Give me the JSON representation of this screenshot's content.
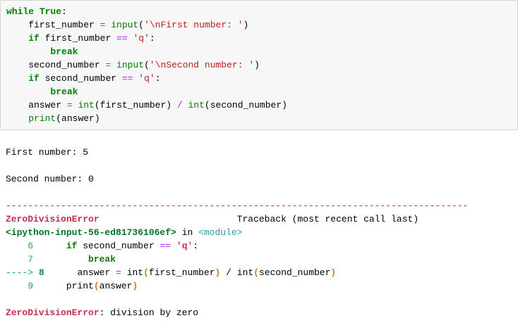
{
  "app": {
    "kind": "ipython-notebook-cell",
    "description": "Python while-loop division cell with ZeroDivisionError traceback"
  },
  "colors": {
    "cell_background": "#f7f7f7",
    "cell_border": "#d4d4d4",
    "keyword_green": "#008000",
    "function_green": "#008000",
    "operator_purple": "#aa22ff",
    "string_red": "#ba2121",
    "traceback_red": "#c5304d",
    "input_ref_green": "#007427",
    "module_teal": "#2e9a9a",
    "lineno_green": "#2aa148",
    "active_lineno_teal": "#0e7c7b",
    "paren_orange": "#d2791e"
  },
  "code_cell": {
    "lines": [
      [
        [
          "while",
          "kw"
        ],
        [
          " "
        ],
        [
          "True",
          "kw"
        ],
        [
          ":"
        ]
      ],
      [
        [
          "    first_number "
        ],
        [
          "=",
          "op"
        ],
        [
          " "
        ],
        [
          "input",
          "fn"
        ],
        [
          "("
        ],
        [
          "'\\nFirst number: '",
          "st"
        ],
        [
          ")"
        ]
      ],
      [
        [
          "    "
        ],
        [
          "if",
          "kw"
        ],
        [
          " first_number "
        ],
        [
          "==",
          "op"
        ],
        [
          " "
        ],
        [
          "'q'",
          "st"
        ],
        [
          ":"
        ]
      ],
      [
        [
          "        "
        ],
        [
          "break",
          "kw"
        ]
      ],
      [
        [
          "    second_number "
        ],
        [
          "=",
          "op"
        ],
        [
          " "
        ],
        [
          "input",
          "fn"
        ],
        [
          "("
        ],
        [
          "'\\nSecond number: '",
          "st"
        ],
        [
          ")"
        ]
      ],
      [
        [
          "    "
        ],
        [
          "if",
          "kw"
        ],
        [
          " second_number "
        ],
        [
          "==",
          "op"
        ],
        [
          " "
        ],
        [
          "'q'",
          "st"
        ],
        [
          ":"
        ]
      ],
      [
        [
          "        "
        ],
        [
          "break",
          "kw"
        ]
      ],
      [
        [
          "    answer "
        ],
        [
          "=",
          "op"
        ],
        [
          " "
        ],
        [
          "int",
          "fn"
        ],
        [
          "(first_number)"
        ],
        [
          " "
        ],
        [
          "/",
          "op"
        ],
        [
          " "
        ],
        [
          "int",
          "fn"
        ],
        [
          "(second_number)"
        ]
      ],
      [
        [
          "    "
        ],
        [
          "print",
          "fn"
        ],
        [
          "(answer)"
        ]
      ]
    ]
  },
  "output": {
    "stdout": [
      "First number: 5",
      "Second number: 0"
    ],
    "error_type": "ZeroDivisionError",
    "error_message": "division by zero",
    "traceback_header": "Traceback (most recent call last)",
    "input_ref": "<ipython-input-56-ed81736106ef>",
    "lines": [
      [
        [
          "First number: 5"
        ]
      ],
      [],
      [
        [
          "Second number: 0"
        ]
      ],
      [],
      [
        [
          "------------------------------------------------------------------------------------",
          "dash"
        ]
      ],
      [
        [
          "ZeroDivisionError",
          "err"
        ],
        [
          "                         "
        ],
        [
          "Traceback (most recent call last)"
        ]
      ],
      [
        [
          "<ipython-input-56-ed81736106ef>",
          "ipin"
        ],
        [
          " in "
        ],
        [
          "<module>",
          "mod"
        ]
      ],
      [
        [
          "    6  ",
          "num"
        ],
        [
          "    "
        ],
        [
          "if",
          "kw"
        ],
        [
          " second_number "
        ],
        [
          "==",
          "op"
        ],
        [
          " "
        ],
        [
          "'q'",
          "tbst"
        ],
        [
          ":"
        ]
      ],
      [
        [
          "    7  ",
          "num"
        ],
        [
          "        "
        ],
        [
          "break",
          "kw"
        ]
      ],
      [
        [
          "---->",
          "num"
        ],
        [
          " "
        ],
        [
          "8",
          "numb"
        ],
        [
          "  "
        ],
        [
          "    answer "
        ],
        [
          "=",
          "op"
        ],
        [
          " "
        ],
        [
          "int"
        ],
        [
          "(",
          "par"
        ],
        [
          "first_number"
        ],
        [
          ")",
          "par"
        ],
        [
          " / "
        ],
        [
          "int"
        ],
        [
          "(",
          "par"
        ],
        [
          "second_number"
        ],
        [
          ")",
          "par"
        ]
      ],
      [
        [
          "    9  ",
          "num"
        ],
        [
          "    "
        ],
        [
          "print"
        ],
        [
          "(",
          "par"
        ],
        [
          "answer"
        ],
        [
          ")",
          "par"
        ]
      ],
      [],
      [
        [
          "ZeroDivisionError",
          "err"
        ],
        [
          ": division by zero"
        ]
      ]
    ]
  }
}
